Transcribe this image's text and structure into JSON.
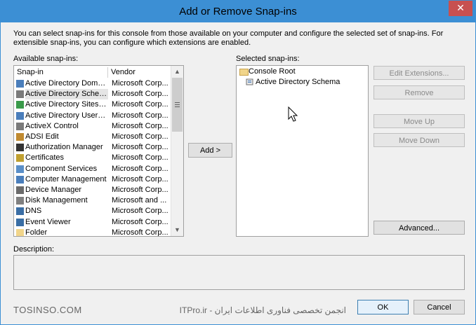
{
  "window": {
    "title": "Add or Remove Snap-ins",
    "close": "✕"
  },
  "intro": "You can select snap-ins for this console from those available on your computer and configure the selected set of snap-ins. For extensible snap-ins, you can configure which extensions are enabled.",
  "available": {
    "label": "Available snap-ins:",
    "col_snapin": "Snap-in",
    "col_vendor": "Vendor",
    "rows": [
      {
        "name": "Active Directory Domai...",
        "vendor": "Microsoft Corp...",
        "icon": "ad-domains-icon"
      },
      {
        "name": "Active Directory Schema",
        "vendor": "Microsoft Corp...",
        "icon": "ad-schema-icon",
        "selected": true
      },
      {
        "name": "Active Directory Sites a...",
        "vendor": "Microsoft Corp...",
        "icon": "ad-sites-icon"
      },
      {
        "name": "Active Directory Users ...",
        "vendor": "Microsoft Corp...",
        "icon": "ad-users-icon"
      },
      {
        "name": "ActiveX Control",
        "vendor": "Microsoft Corp...",
        "icon": "activex-icon"
      },
      {
        "name": "ADSI Edit",
        "vendor": "Microsoft Corp...",
        "icon": "adsi-edit-icon"
      },
      {
        "name": "Authorization Manager",
        "vendor": "Microsoft Corp...",
        "icon": "authorization-icon"
      },
      {
        "name": "Certificates",
        "vendor": "Microsoft Corp...",
        "icon": "certificates-icon"
      },
      {
        "name": "Component Services",
        "vendor": "Microsoft Corp...",
        "icon": "component-services-icon"
      },
      {
        "name": "Computer Management",
        "vendor": "Microsoft Corp...",
        "icon": "computer-management-icon"
      },
      {
        "name": "Device Manager",
        "vendor": "Microsoft Corp...",
        "icon": "device-manager-icon"
      },
      {
        "name": "Disk Management",
        "vendor": "Microsoft and ...",
        "icon": "disk-management-icon"
      },
      {
        "name": "DNS",
        "vendor": "Microsoft Corp...",
        "icon": "dns-icon"
      },
      {
        "name": "Event Viewer",
        "vendor": "Microsoft Corp...",
        "icon": "event-viewer-icon"
      },
      {
        "name": "Folder",
        "vendor": "Microsoft Corp...",
        "icon": "folder-icon"
      }
    ]
  },
  "add_button": "Add >",
  "selected": {
    "label": "Selected snap-ins:",
    "root": "Console Root",
    "child": "Active Directory Schema"
  },
  "side_buttons": {
    "edit_extensions": "Edit Extensions...",
    "remove": "Remove",
    "move_up": "Move Up",
    "move_down": "Move Down",
    "advanced": "Advanced..."
  },
  "description_label": "Description:",
  "ok": "OK",
  "cancel": "Cancel",
  "watermark_left": "TOSINSO.COM",
  "watermark_right": "انجمن تخصصی فناوری اطلاعات ایران - ITPro.ir",
  "colors": {
    "titlebar": "#3c8fd4",
    "close": "#c75050",
    "folder": "#f1d58a"
  }
}
